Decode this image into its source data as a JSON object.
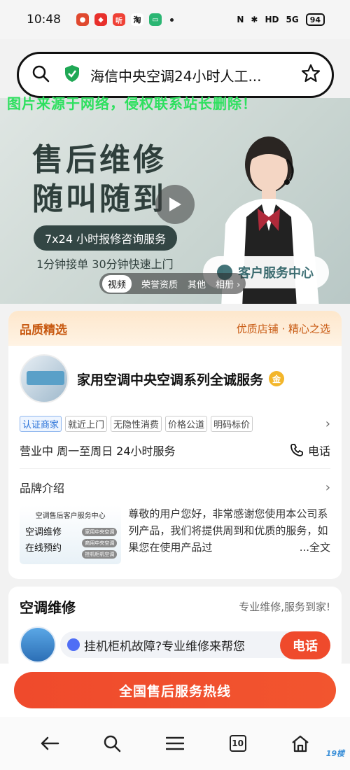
{
  "status_bar": {
    "time": "10:48",
    "battery": "94",
    "network": "5G",
    "hd": "HD"
  },
  "address_bar": {
    "title": "海信中央空调24小时人工..."
  },
  "watermark": "图片来源于网络，侵权联系站长删除！",
  "banner": {
    "headline_1": "售后维修",
    "headline_2": "随叫随到",
    "pill": "7x24 小时报修咨询服务",
    "subline": "1分钟接单 30分钟快速上门",
    "service_center": "客户服务中心",
    "tabs": [
      "视频",
      "荣誉资质",
      "其他",
      "相册 ›"
    ]
  },
  "quality": {
    "title": "品质精选",
    "right": "优质店铺 · 精心之选",
    "shop_name": "家用空调中央空调系列全诚服务",
    "gold_badge": "金",
    "tags": [
      "认证商家",
      "就近上门",
      "无隐性消费",
      "价格公道",
      "明码标价"
    ],
    "hours": "营业中  周一至周日 24小时服务",
    "phone_label": "电话",
    "brand_title": "品牌介绍",
    "thumb_title": "空调售后客户服务中心",
    "thumb_line1": "空调维修",
    "thumb_line2": "在线预约",
    "thumb_chips": [
      "家用中央空调",
      "商用中央空调",
      "挂机柜机空调"
    ],
    "description": "尊敬的用户您好，非常感谢您使用本公司系列产品，我们将提供周到和优质的服务，如果您在使用产品过",
    "more": "...全文"
  },
  "repair": {
    "title": "空调维修",
    "right": "专业维修,服务到家!",
    "input_text": "挂机柜机故障?专业维修来帮您",
    "call_label": "电话"
  },
  "cta": {
    "label": "全国售后服务热线"
  },
  "nav": {
    "tab_count": "10"
  },
  "corner_mark": "19楼"
}
